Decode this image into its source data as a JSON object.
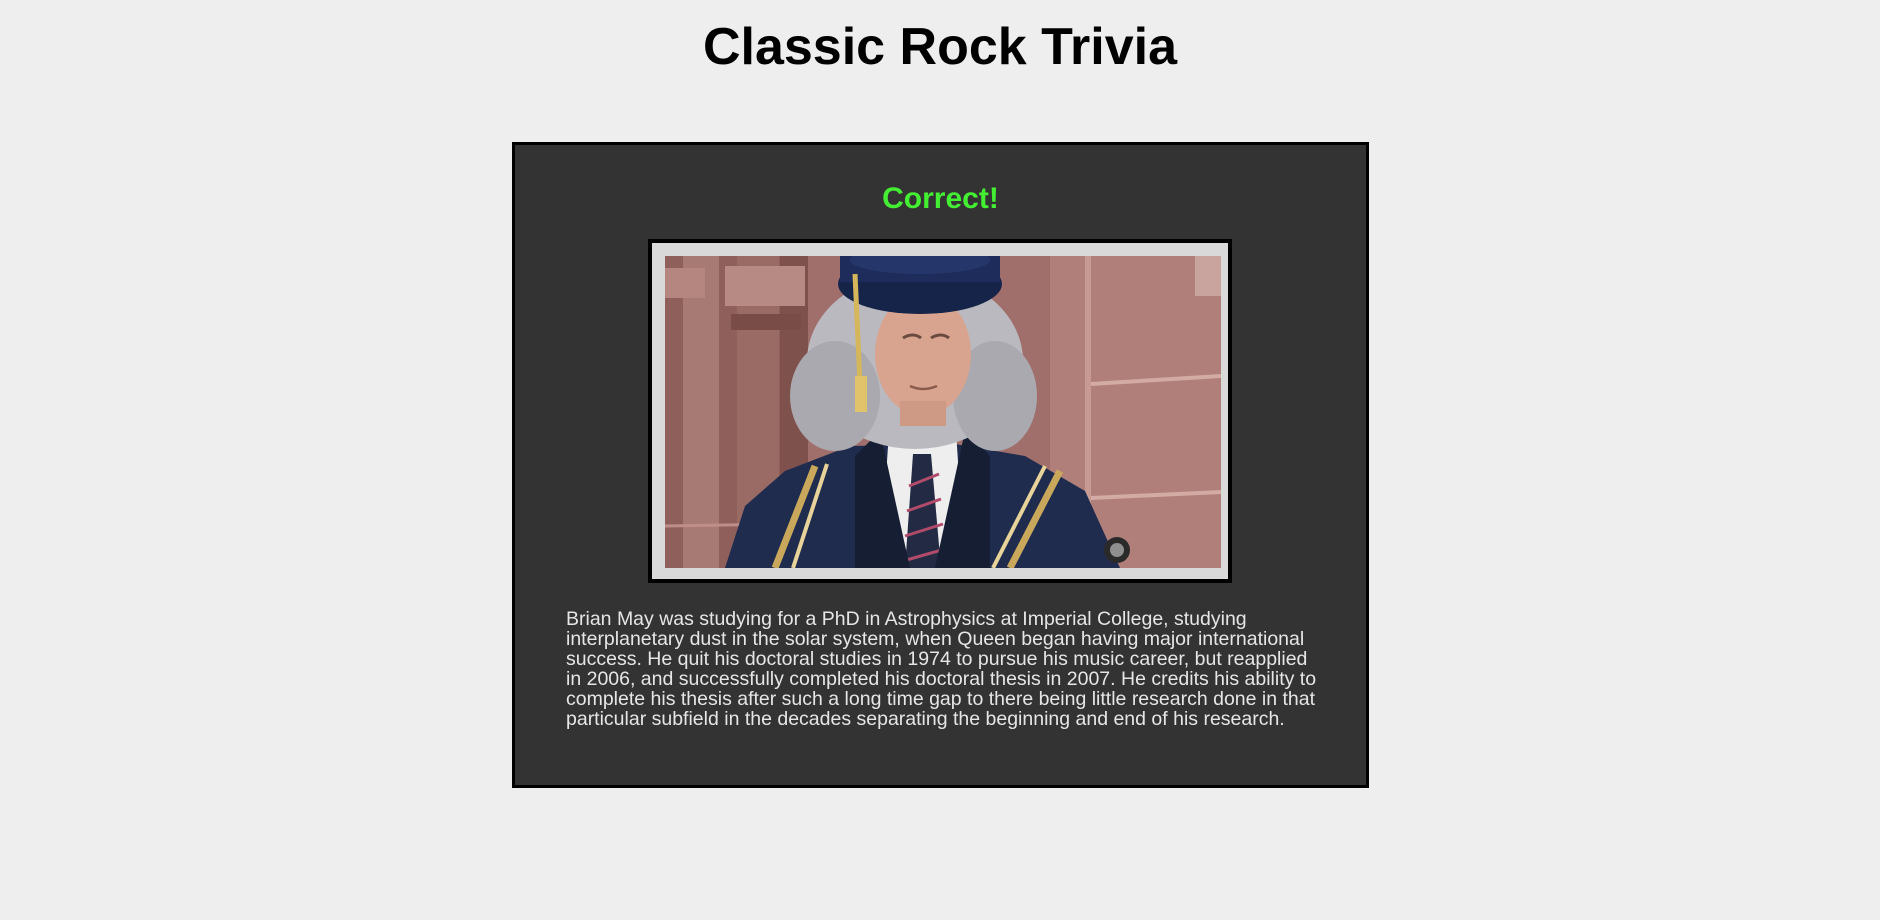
{
  "page": {
    "title": "Classic Rock Trivia"
  },
  "result": {
    "heading": "Correct!",
    "heading_color": "#44ee33",
    "photo_subject": "portrait-photo",
    "fact": "Brian May was studying for a PhD in Astrophysics at Imperial College, studying interplanetary dust in the solar system, when Queen began having major international success. He quit his doctoral studies in 1974 to pursue his music career, but reapplied in 2006, and successfully completed his doctoral thesis in 2007. He credits his ability to complete his thesis after such a long time gap to there being little research done in that particular subfield in the decades separating the beginning and end of his research."
  },
  "colors": {
    "page_background": "#eeeeee",
    "panel_background": "#333333",
    "panel_border": "#000000",
    "text_light": "#e6e6e6"
  }
}
